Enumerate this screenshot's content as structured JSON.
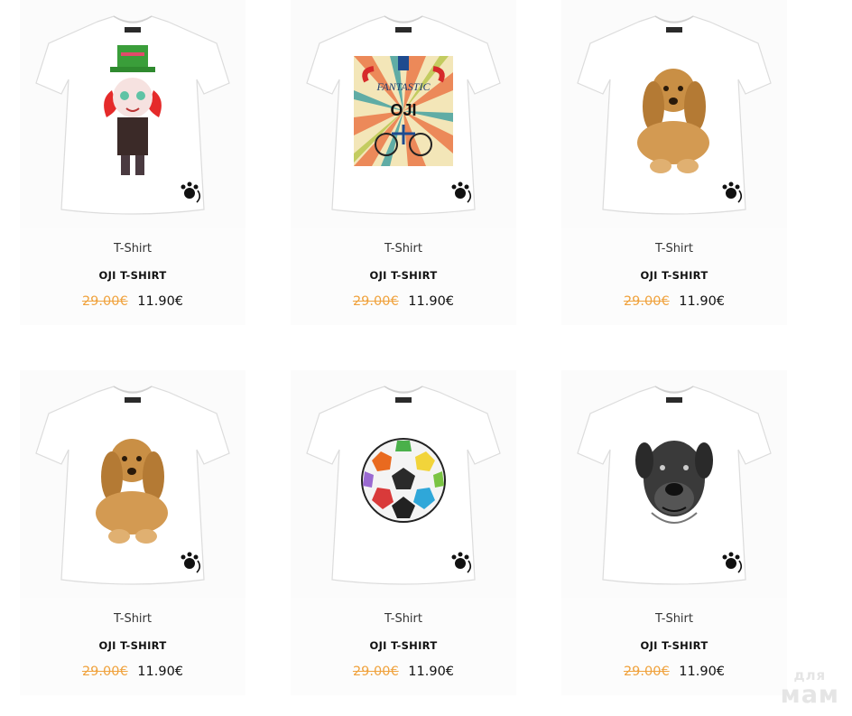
{
  "products": [
    {
      "category": "T-Shirt",
      "name": "OJI T-SHIRT",
      "old_price": "29.00€",
      "price": "11.90€",
      "print": "mad-hatter-character",
      "print_icon": "mad-hatter-print-icon"
    },
    {
      "category": "T-Shirt",
      "name": "OJI T-SHIRT",
      "old_price": "29.00€",
      "price": "11.90€",
      "print": "fantastic-oji-poster",
      "print_icon": "fantastic-oji-print-icon",
      "print_text_top": "FANTASTIC",
      "print_text_bottom": "OJI"
    },
    {
      "category": "T-Shirt",
      "name": "OJI T-SHIRT",
      "old_price": "29.00€",
      "price": "11.90€",
      "print": "cocker-spaniel",
      "print_icon": "cocker-spaniel-print-icon"
    },
    {
      "category": "T-Shirt",
      "name": "OJI T-SHIRT",
      "old_price": "29.00€",
      "price": "11.90€",
      "print": "cocker-spaniel",
      "print_icon": "cocker-spaniel-print-icon"
    },
    {
      "category": "T-Shirt",
      "name": "OJI T-SHIRT",
      "old_price": "29.00€",
      "price": "11.90€",
      "print": "colorful-soccer-ball",
      "print_icon": "soccer-ball-print-icon"
    },
    {
      "category": "T-Shirt",
      "name": "OJI T-SHIRT",
      "old_price": "29.00€",
      "price": "11.90€",
      "print": "cane-corso-dog",
      "print_icon": "mastiff-print-icon"
    }
  ],
  "watermark": {
    "top": "для",
    "bottom": "мам"
  },
  "colors": {
    "old_price": "#f0a23d",
    "price": "#111111",
    "shirt": "#ffffff"
  }
}
